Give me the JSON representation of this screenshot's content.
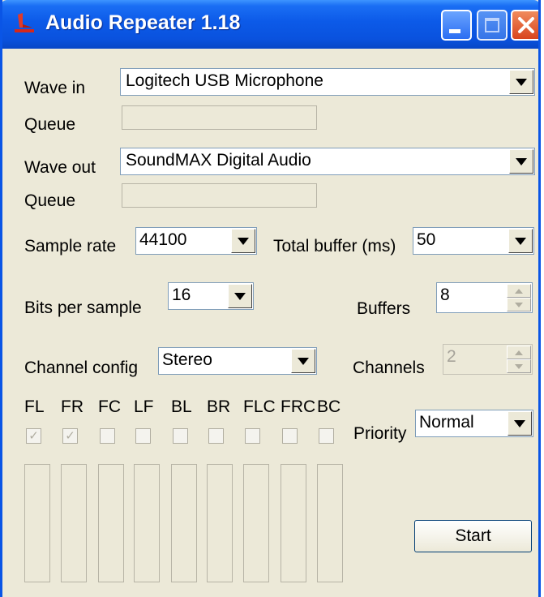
{
  "window": {
    "title": "Audio Repeater 1.18"
  },
  "wave_in": {
    "label": "Wave in",
    "value": "Logitech USB Microphone",
    "queue_label": "Queue"
  },
  "wave_out": {
    "label": "Wave out",
    "value": "SoundMAX Digital Audio",
    "queue_label": "Queue"
  },
  "sample_rate": {
    "label": "Sample rate",
    "value": "44100"
  },
  "total_buffer": {
    "label": "Total buffer (ms)",
    "value": "50"
  },
  "bits_per_sample": {
    "label": "Bits per sample",
    "value": "16"
  },
  "buffers": {
    "label": "Buffers",
    "value": "8"
  },
  "channel_config": {
    "label": "Channel config",
    "value": "Stereo"
  },
  "channels": {
    "label": "Channels",
    "value": "2"
  },
  "speakers": [
    {
      "label": "FL",
      "checked": true
    },
    {
      "label": "FR",
      "checked": true
    },
    {
      "label": "FC",
      "checked": false
    },
    {
      "label": "LF",
      "checked": false
    },
    {
      "label": "BL",
      "checked": false
    },
    {
      "label": "BR",
      "checked": false
    },
    {
      "label": "FLC",
      "checked": false
    },
    {
      "label": "FRC",
      "checked": false
    },
    {
      "label": "BC",
      "checked": false
    }
  ],
  "priority": {
    "label": "Priority",
    "value": "Normal"
  },
  "start_button": {
    "label": "Start"
  },
  "colors": {
    "titlebar": "#0a52de",
    "window_bg": "#ece9d8",
    "close_button": "#d8441e"
  }
}
